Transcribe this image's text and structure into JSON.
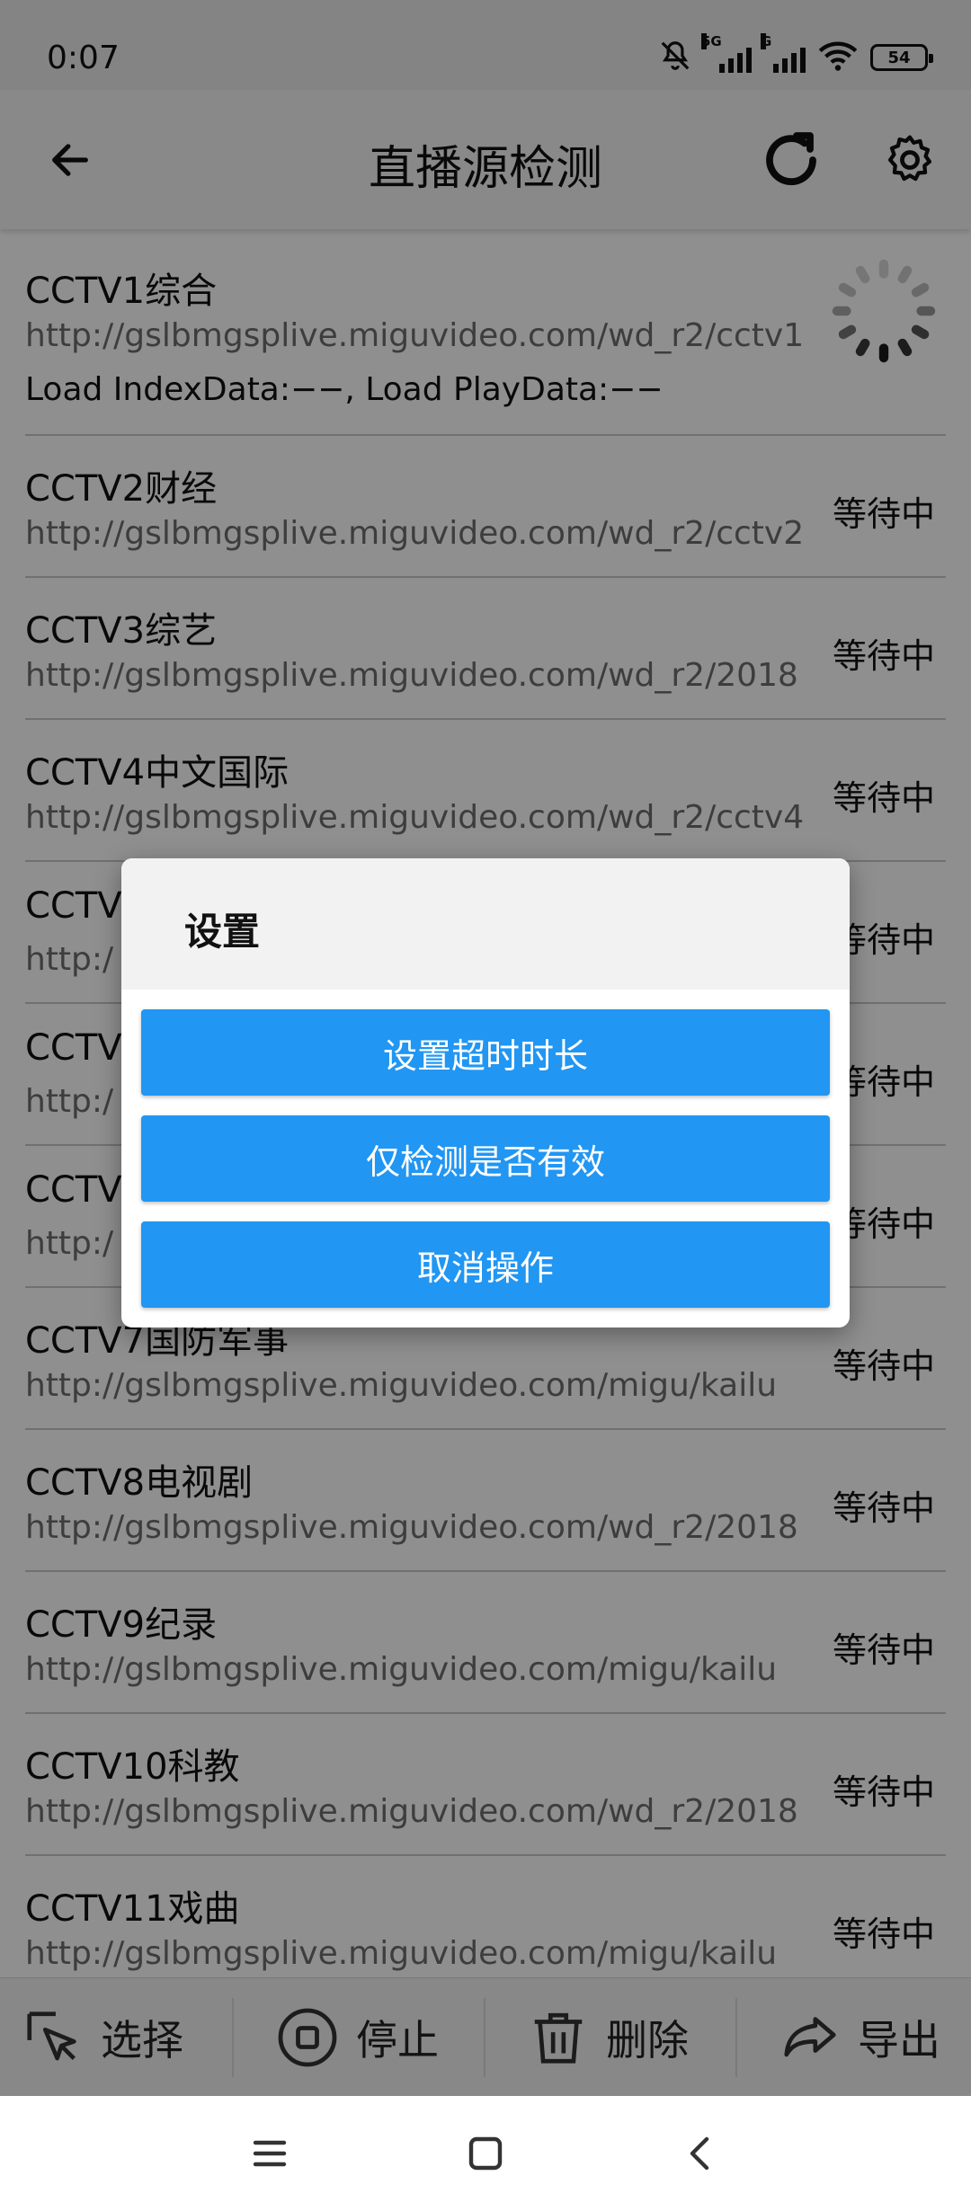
{
  "status_bar": {
    "time": "0:07",
    "network_primary": "5G",
    "network_secondary": "G",
    "battery_level": "54"
  },
  "app_bar": {
    "title": "直播源检测",
    "back_icon": "arrow-left-icon",
    "refresh_icon": "refresh-icon",
    "settings_icon": "gear-icon"
  },
  "channels": [
    {
      "name": "CCTV1综合",
      "url": "http://gslbmgsplive.miguvideo.com/wd_r2/cctv1",
      "status": "",
      "detail": "Load IndexData:−−, Load PlayData:−−"
    },
    {
      "name": "CCTV2财经",
      "url": "http://gslbmgsplive.miguvideo.com/wd_r2/cctv2",
      "status": "等待中"
    },
    {
      "name": "CCTV3综艺",
      "url": "http://gslbmgsplive.miguvideo.com/wd_r2/2018",
      "status": "等待中"
    },
    {
      "name": "CCTV4中文国际",
      "url": "http://gslbmgsplive.miguvideo.com/wd_r2/cctv4",
      "status": "等待中"
    },
    {
      "name": "CCTV",
      "url": "http:/",
      "status": "等待中"
    },
    {
      "name": "CCTV",
      "url": "http:/",
      "status": "等待中"
    },
    {
      "name": "CCTV",
      "url": "http:/",
      "status": "等待中"
    },
    {
      "name": "CCTV7国防军事",
      "url": "http://gslbmgsplive.miguvideo.com/migu/kailu",
      "status": "等待中"
    },
    {
      "name": "CCTV8电视剧",
      "url": "http://gslbmgsplive.miguvideo.com/wd_r2/2018",
      "status": "等待中"
    },
    {
      "name": "CCTV9纪录",
      "url": "http://gslbmgsplive.miguvideo.com/migu/kailu",
      "status": "等待中"
    },
    {
      "name": "CCTV10科教",
      "url": "http://gslbmgsplive.miguvideo.com/wd_r2/2018",
      "status": "等待中"
    },
    {
      "name": "CCTV11戏曲",
      "url": "http://gslbmgsplive.miguvideo.com/migu/kailu",
      "status": "等待中"
    }
  ],
  "toolbar": {
    "select_label": "选择",
    "stop_label": "停止",
    "delete_label": "删除",
    "export_label": "导出"
  },
  "dialog": {
    "title": "设置",
    "buttons": [
      "设置超时时长",
      "仅检测是否有效",
      "取消操作"
    ]
  },
  "colors": {
    "accent": "#2196f3",
    "status_bar_bg": "#ececec",
    "app_bar_bg": "#f5f5f5",
    "overlay": "rgba(0,0,0,0.44)"
  }
}
